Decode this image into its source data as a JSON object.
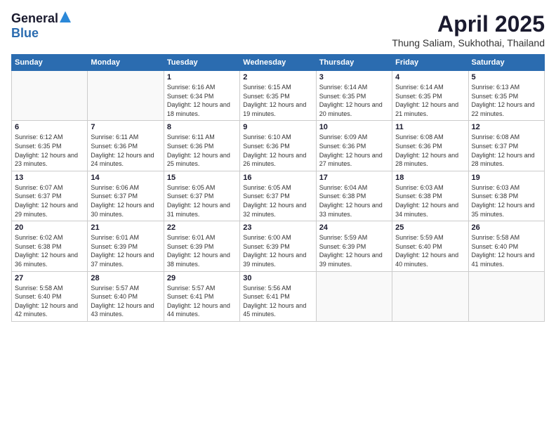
{
  "logo": {
    "general": "General",
    "blue": "Blue"
  },
  "title": "April 2025",
  "location": "Thung Saliam, Sukhothai, Thailand",
  "headers": [
    "Sunday",
    "Monday",
    "Tuesday",
    "Wednesday",
    "Thursday",
    "Friday",
    "Saturday"
  ],
  "weeks": [
    [
      {
        "day": "",
        "info": ""
      },
      {
        "day": "",
        "info": ""
      },
      {
        "day": "1",
        "info": "Sunrise: 6:16 AM\nSunset: 6:34 PM\nDaylight: 12 hours and 18 minutes."
      },
      {
        "day": "2",
        "info": "Sunrise: 6:15 AM\nSunset: 6:35 PM\nDaylight: 12 hours and 19 minutes."
      },
      {
        "day": "3",
        "info": "Sunrise: 6:14 AM\nSunset: 6:35 PM\nDaylight: 12 hours and 20 minutes."
      },
      {
        "day": "4",
        "info": "Sunrise: 6:14 AM\nSunset: 6:35 PM\nDaylight: 12 hours and 21 minutes."
      },
      {
        "day": "5",
        "info": "Sunrise: 6:13 AM\nSunset: 6:35 PM\nDaylight: 12 hours and 22 minutes."
      }
    ],
    [
      {
        "day": "6",
        "info": "Sunrise: 6:12 AM\nSunset: 6:35 PM\nDaylight: 12 hours and 23 minutes."
      },
      {
        "day": "7",
        "info": "Sunrise: 6:11 AM\nSunset: 6:36 PM\nDaylight: 12 hours and 24 minutes."
      },
      {
        "day": "8",
        "info": "Sunrise: 6:11 AM\nSunset: 6:36 PM\nDaylight: 12 hours and 25 minutes."
      },
      {
        "day": "9",
        "info": "Sunrise: 6:10 AM\nSunset: 6:36 PM\nDaylight: 12 hours and 26 minutes."
      },
      {
        "day": "10",
        "info": "Sunrise: 6:09 AM\nSunset: 6:36 PM\nDaylight: 12 hours and 27 minutes."
      },
      {
        "day": "11",
        "info": "Sunrise: 6:08 AM\nSunset: 6:36 PM\nDaylight: 12 hours and 28 minutes."
      },
      {
        "day": "12",
        "info": "Sunrise: 6:08 AM\nSunset: 6:37 PM\nDaylight: 12 hours and 28 minutes."
      }
    ],
    [
      {
        "day": "13",
        "info": "Sunrise: 6:07 AM\nSunset: 6:37 PM\nDaylight: 12 hours and 29 minutes."
      },
      {
        "day": "14",
        "info": "Sunrise: 6:06 AM\nSunset: 6:37 PM\nDaylight: 12 hours and 30 minutes."
      },
      {
        "day": "15",
        "info": "Sunrise: 6:05 AM\nSunset: 6:37 PM\nDaylight: 12 hours and 31 minutes."
      },
      {
        "day": "16",
        "info": "Sunrise: 6:05 AM\nSunset: 6:37 PM\nDaylight: 12 hours and 32 minutes."
      },
      {
        "day": "17",
        "info": "Sunrise: 6:04 AM\nSunset: 6:38 PM\nDaylight: 12 hours and 33 minutes."
      },
      {
        "day": "18",
        "info": "Sunrise: 6:03 AM\nSunset: 6:38 PM\nDaylight: 12 hours and 34 minutes."
      },
      {
        "day": "19",
        "info": "Sunrise: 6:03 AM\nSunset: 6:38 PM\nDaylight: 12 hours and 35 minutes."
      }
    ],
    [
      {
        "day": "20",
        "info": "Sunrise: 6:02 AM\nSunset: 6:38 PM\nDaylight: 12 hours and 36 minutes."
      },
      {
        "day": "21",
        "info": "Sunrise: 6:01 AM\nSunset: 6:39 PM\nDaylight: 12 hours and 37 minutes."
      },
      {
        "day": "22",
        "info": "Sunrise: 6:01 AM\nSunset: 6:39 PM\nDaylight: 12 hours and 38 minutes."
      },
      {
        "day": "23",
        "info": "Sunrise: 6:00 AM\nSunset: 6:39 PM\nDaylight: 12 hours and 39 minutes."
      },
      {
        "day": "24",
        "info": "Sunrise: 5:59 AM\nSunset: 6:39 PM\nDaylight: 12 hours and 39 minutes."
      },
      {
        "day": "25",
        "info": "Sunrise: 5:59 AM\nSunset: 6:40 PM\nDaylight: 12 hours and 40 minutes."
      },
      {
        "day": "26",
        "info": "Sunrise: 5:58 AM\nSunset: 6:40 PM\nDaylight: 12 hours and 41 minutes."
      }
    ],
    [
      {
        "day": "27",
        "info": "Sunrise: 5:58 AM\nSunset: 6:40 PM\nDaylight: 12 hours and 42 minutes."
      },
      {
        "day": "28",
        "info": "Sunrise: 5:57 AM\nSunset: 6:40 PM\nDaylight: 12 hours and 43 minutes."
      },
      {
        "day": "29",
        "info": "Sunrise: 5:57 AM\nSunset: 6:41 PM\nDaylight: 12 hours and 44 minutes."
      },
      {
        "day": "30",
        "info": "Sunrise: 5:56 AM\nSunset: 6:41 PM\nDaylight: 12 hours and 45 minutes."
      },
      {
        "day": "",
        "info": ""
      },
      {
        "day": "",
        "info": ""
      },
      {
        "day": "",
        "info": ""
      }
    ]
  ]
}
